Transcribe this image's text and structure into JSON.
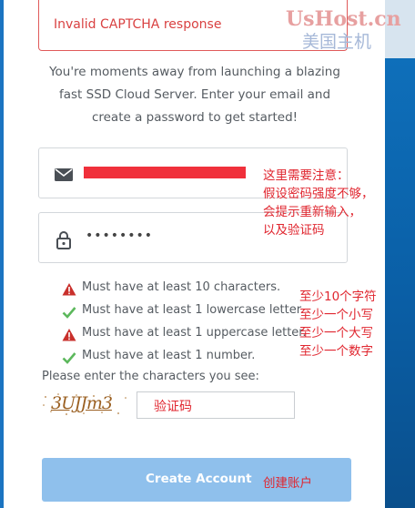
{
  "error": {
    "message": "Invalid CAPTCHA response"
  },
  "intro": {
    "lines": [
      "You're moments away from launching a blazing",
      "fast SSD Cloud Server. Enter your email and",
      "create a password to get started!"
    ]
  },
  "email_field": {
    "icon": "envelope-icon",
    "value_redacted": true
  },
  "password_field": {
    "icon": "lock-icon",
    "value": "••••••••"
  },
  "password_rules": [
    {
      "text": "Must have at least 10 characters.",
      "status": "fail"
    },
    {
      "text": "Must have at least 1 lowercase letter.",
      "status": "pass"
    },
    {
      "text": "Must have at least 1 uppercase letter.",
      "status": "fail"
    },
    {
      "text": "Must have at least 1 number.",
      "status": "pass"
    }
  ],
  "captcha": {
    "label": "Please enter the characters you see:",
    "image_text": "3UJJm3",
    "input_value": "验证码"
  },
  "create_button": {
    "label": "Create Account",
    "note": "创建账户"
  },
  "annotations": {
    "note_lines": [
      "这里需要注意：",
      "假设密码强度不够，",
      "会提示重新输入，",
      "以及验证码"
    ],
    "rule_notes": [
      "至少10个字符",
      "至少一个小写",
      "至少一个大写",
      "至少一个数字"
    ]
  },
  "watermark": {
    "line1": "UsHost.cn",
    "line2": "美国主机"
  },
  "colors": {
    "error_red": "#d94141",
    "pass_green": "#5cb85c",
    "fail_red": "#c9302c",
    "button_blue": "#8fc0ec",
    "annotation_red": "#e0262f"
  }
}
